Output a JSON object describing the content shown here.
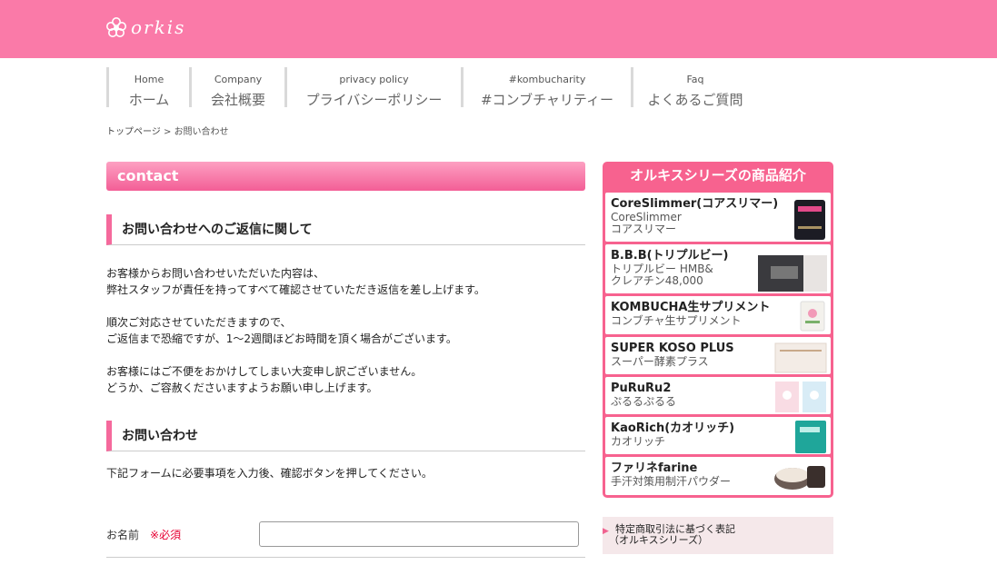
{
  "header": {
    "brand": "orkis"
  },
  "nav": [
    {
      "en": "Home",
      "jp": "ホーム"
    },
    {
      "en": "Company",
      "jp": "会社概要"
    },
    {
      "en": "privacy policy",
      "jp": "プライバシーポリシー"
    },
    {
      "en": "#kombucharity",
      "jp": "#コンブチャリティー"
    },
    {
      "en": "Faq",
      "jp": "よくあるご質問"
    }
  ],
  "breadcrumb": {
    "home": "トップページ",
    "separator": " > ",
    "current": "お問い合わせ"
  },
  "main": {
    "bar_title": "contact",
    "section1_title": "お問い合わせへのご返信に関して",
    "p1_line1": "お客様からお問い合わせいただいた内容は、",
    "p1_line2": "弊社スタッフが責任を持ってすべて確認させていただき返信を差し上げます。",
    "p2_line1": "順次ご対応させていただきますので、",
    "p2_line2": "ご返信まで恐縮ですが、1〜2週間ほどお時間を頂く場合がございます。",
    "p3_line1": "お客様にはご不便をおかけしてしまい大変申し訳ございません。",
    "p3_line2": "どうか、ご容赦くださいますようお願い申し上げます。",
    "section2_title": "お問い合わせ",
    "form_intro": "下記フォームに必要事項を入力後、確認ボタンを押してください。",
    "name_label": "お名前",
    "required_mark": "※必須",
    "name_value": ""
  },
  "sidebar": {
    "products_title": "オルキスシリーズの商品紹介",
    "products": [
      {
        "name": "CoreSlimmer(コアスリマー)",
        "sub1": "CoreSlimmer",
        "sub2": "コアスリマー"
      },
      {
        "name": "B.B.B(トリプルビー)",
        "sub1": "トリプルビー HMB&",
        "sub2": "クレアチン48,000"
      },
      {
        "name": "KOMBUCHA生サプリメント",
        "sub1": "コンブチャ生サプリメント",
        "sub2": ""
      },
      {
        "name": "SUPER KOSO PLUS",
        "sub1": "スーパー酵素プラス",
        "sub2": ""
      },
      {
        "name": "PuRuRu2",
        "sub1": "ぷるるぷるる",
        "sub2": ""
      },
      {
        "name": "KaoRich(カオリッチ)",
        "sub1": "カオリッチ",
        "sub2": ""
      },
      {
        "name": "ファリネfarine",
        "sub1": "手汗対策用制汗パウダー",
        "sub2": ""
      }
    ],
    "link1_line1": "特定商取引法に基づく表記",
    "link1_line2": "（オルキスシリーズ）"
  },
  "colors": {
    "brand_pink": "#fa7aa8",
    "accent_pink": "#f5699c",
    "required_red": "#e60033"
  }
}
